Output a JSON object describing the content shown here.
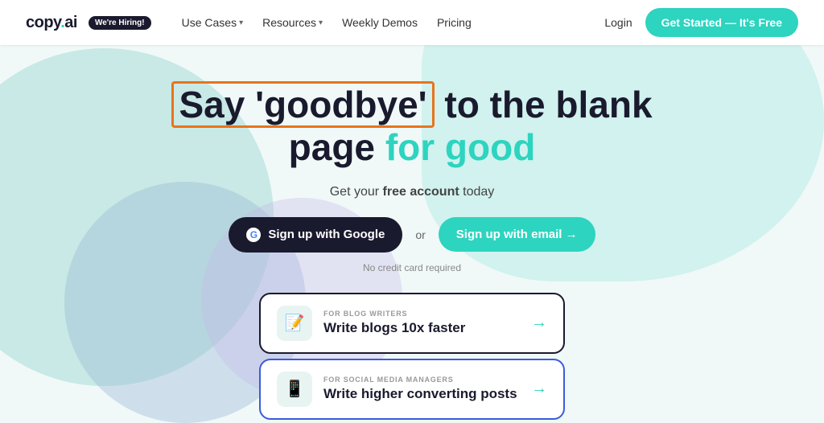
{
  "logo": {
    "text": "copy",
    "dot": ".",
    "suffix": "ai",
    "hiring_badge": "We're Hiring!"
  },
  "nav": {
    "links": [
      {
        "label": "Use Cases",
        "has_dropdown": true
      },
      {
        "label": "Resources",
        "has_dropdown": true
      },
      {
        "label": "Weekly Demos",
        "has_dropdown": false
      },
      {
        "label": "Pricing",
        "has_dropdown": false
      }
    ],
    "login_label": "Login",
    "cta_label": "Get Started — It's Free"
  },
  "headline": {
    "line1_prefix": "Say ‘goodbye’",
    "line1_suffix": " to the blank",
    "line2_prefix": "page ",
    "line2_accent": "for good"
  },
  "subheading": {
    "text": "Get your free account today"
  },
  "buttons": {
    "google_label": "Sign up with Google",
    "or_text": "or",
    "email_label": "Sign up with email →"
  },
  "no_cc": "No credit card required",
  "cards": [
    {
      "label": "FOR BLOG WRITERS",
      "title": "Write blogs 10x faster",
      "icon": "📝"
    },
    {
      "label": "FOR SOCIAL MEDIA MANAGERS",
      "title": "Write higher converting posts",
      "icon": "📱"
    }
  ]
}
